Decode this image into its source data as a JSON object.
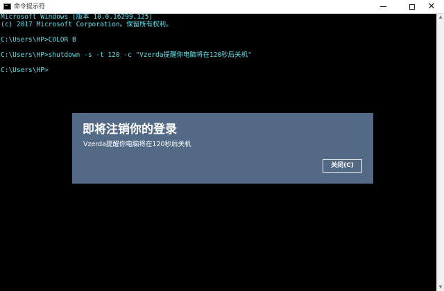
{
  "window": {
    "title": "命令提示符",
    "buttons": {
      "minimize": "minimize",
      "maximize": "maximize",
      "close": "✕"
    }
  },
  "console": {
    "text_color": "#5fe0e8",
    "background": "#000000",
    "lines": [
      "Microsoft Windows [版本 10.0.16299.125]",
      "(c) 2017 Microsoft Corporation。保留所有权利。",
      "",
      "C:\\Users\\HP>COLOR B",
      "",
      "C:\\Users\\HP>shutdown -s -t 120 -c \"Vzerda提醒你电脑将在120秒后关机\"",
      "",
      "C:\\Users\\HP>"
    ]
  },
  "dialog": {
    "title": "即将注销你的登录",
    "message": "Vzerda提醒你电脑将在120秒后关机",
    "close_button": "关闭(C)",
    "background": "#536a87"
  }
}
